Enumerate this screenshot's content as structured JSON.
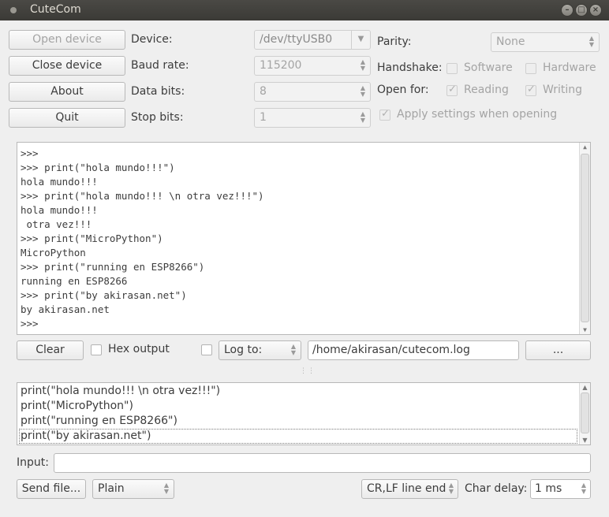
{
  "window": {
    "title": "CuteCom"
  },
  "buttons": {
    "open_device": "Open device",
    "close_device": "Close device",
    "about": "About",
    "quit": "Quit",
    "clear": "Clear",
    "log_browse": "...",
    "send_file": "Send file..."
  },
  "settings": {
    "device_label": "Device:",
    "device_value": "/dev/ttyUSB0",
    "baud_label": "Baud rate:",
    "baud_value": "115200",
    "databits_label": "Data bits:",
    "databits_value": "8",
    "stopbits_label": "Stop bits:",
    "stopbits_value": "1",
    "parity_label": "Parity:",
    "parity_value": "None",
    "handshake_label": "Handshake:",
    "handshake_software": "Software",
    "handshake_hardware": "Hardware",
    "openfor_label": "Open for:",
    "openfor_reading": "Reading",
    "openfor_writing": "Writing",
    "apply_settings": "Apply settings when opening"
  },
  "output": {
    "lines": [
      ">>>",
      ">>> print(\"hola mundo!!!\")",
      "hola mundo!!!",
      ">>> print(\"hola mundo!!! \\n otra vez!!!\")",
      "hola mundo!!!",
      " otra vez!!!",
      ">>> print(\"MicroPython\")",
      "MicroPython",
      ">>> print(\"running en ESP8266\")",
      "running en ESP8266",
      ">>> print(\"by akirasan.net\")",
      "by akirasan.net",
      ">>>"
    ]
  },
  "logbar": {
    "hex_output": "Hex output",
    "log_to": "Log to:",
    "log_path": "/home/akirasan/cutecom.log"
  },
  "history": {
    "lines": [
      "print(\"hola mundo!!! \\n otra vez!!!\")",
      "print(\"MicroPython\")",
      "print(\"running en ESP8266\")",
      "print(\"by akirasan.net\")"
    ]
  },
  "inputbar": {
    "label": "Input:",
    "value": ""
  },
  "bottom": {
    "format": "Plain",
    "line_end": "CR,LF line end",
    "char_delay_label": "Char delay:",
    "char_delay_value": "1 ms"
  },
  "colors": {
    "titlebar": "#3c3b37",
    "window_bg": "#efefef"
  }
}
